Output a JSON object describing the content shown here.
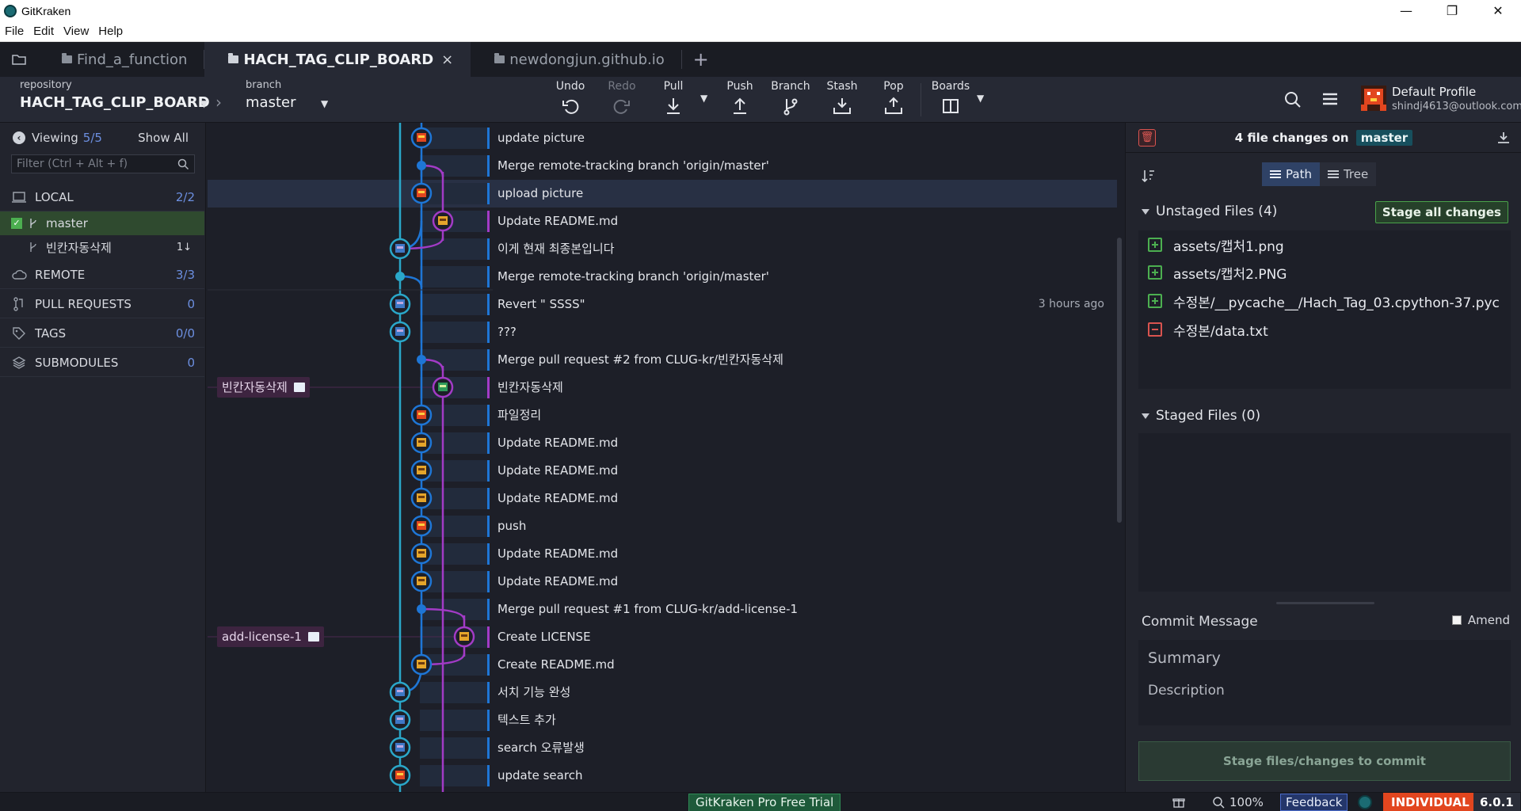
{
  "app": {
    "title": "GitKraken"
  },
  "menu": [
    "File",
    "Edit",
    "View",
    "Help"
  ],
  "tabs": [
    {
      "label": "Find_a_function",
      "active": false
    },
    {
      "label": "HACH_TAG_CLIP_BOARD",
      "active": true,
      "close": "×"
    },
    {
      "label": "newdongjun.github.io",
      "active": false
    }
  ],
  "toolbar": {
    "repo_caption": "repository",
    "repo_name": "HACH_TAG_CLIP_BOARD",
    "branch_caption": "branch",
    "branch_name": "master",
    "undo": "Undo",
    "redo": "Redo",
    "pull": "Pull",
    "push": "Push",
    "branch": "Branch",
    "stash": "Stash",
    "pop": "Pop",
    "boards": "Boards",
    "profile_name": "Default Profile",
    "profile_email": "shindj4613@outlook.com"
  },
  "sidebar": {
    "viewing_label": "Viewing",
    "viewing_count": "5/5",
    "show_all": "Show All",
    "filter_placeholder": "Filter (Ctrl + Alt + f)",
    "local": {
      "label": "LOCAL",
      "count": "2/2"
    },
    "local_branches": [
      {
        "name": "master",
        "checked": true,
        "badge": ""
      },
      {
        "name": "빈칸자동삭제",
        "checked": false,
        "badge": "1↓"
      }
    ],
    "remote": {
      "label": "REMOTE",
      "count": "3/3"
    },
    "pull_requests": {
      "label": "PULL REQUESTS",
      "count": "0"
    },
    "tags": {
      "label": "TAGS",
      "count": "0/0"
    },
    "submodules": {
      "label": "SUBMODULES",
      "count": "0"
    }
  },
  "graph": {
    "commits": [
      {
        "message": "update picture",
        "lane": 1,
        "avatar": "red",
        "bar": "blue"
      },
      {
        "message": "Merge remote-tracking branch 'origin/master'",
        "lane": 1,
        "avatar": "dot",
        "bar": "blue"
      },
      {
        "message": "upload picture",
        "lane": 1,
        "avatar": "red",
        "bar": "blue",
        "selected": true
      },
      {
        "message": "Update README.md",
        "lane": 2,
        "avatar": "yellow",
        "bar": "purple"
      },
      {
        "message": "이게 현재 최종본입니다",
        "lane": 0,
        "avatar": "blue",
        "bar": "blue"
      },
      {
        "message": "Merge remote-tracking branch 'origin/master'",
        "lane": 0,
        "avatar": "dot",
        "bar": "blue"
      },
      {
        "message": "Revert \" SSSS\"",
        "lane": 0,
        "avatar": "blue",
        "bar": "blue",
        "when": "3 hours ago"
      },
      {
        "message": "???",
        "lane": 0,
        "avatar": "blue",
        "bar": "blue"
      },
      {
        "message": "Merge pull request #2 from CLUG-kr/빈칸자동삭제",
        "lane": 1,
        "avatar": "dot",
        "bar": "blue"
      },
      {
        "message": "빈칸자동삭제",
        "lane": 2,
        "avatar": "green",
        "bar": "purple"
      },
      {
        "message": "파일정리",
        "lane": 1,
        "avatar": "red",
        "bar": "blue"
      },
      {
        "message": "Update README.md",
        "lane": 1,
        "avatar": "yellow",
        "bar": "blue"
      },
      {
        "message": "Update README.md",
        "lane": 1,
        "avatar": "yellow",
        "bar": "blue"
      },
      {
        "message": "Update README.md",
        "lane": 1,
        "avatar": "yellow",
        "bar": "blue"
      },
      {
        "message": "push",
        "lane": 1,
        "avatar": "red",
        "bar": "blue"
      },
      {
        "message": "Update README.md",
        "lane": 1,
        "avatar": "yellow",
        "bar": "blue"
      },
      {
        "message": "Update README.md",
        "lane": 1,
        "avatar": "yellow",
        "bar": "blue"
      },
      {
        "message": "Merge pull request #1 from CLUG-kr/add-license-1",
        "lane": 1,
        "avatar": "dot",
        "bar": "blue"
      },
      {
        "message": "Create LICENSE",
        "lane": 3,
        "avatar": "yellow",
        "bar": "purple"
      },
      {
        "message": "Create README.md",
        "lane": 1,
        "avatar": "yellow",
        "bar": "blue"
      },
      {
        "message": "서치 기능 완성",
        "lane": 0,
        "avatar": "blue",
        "bar": "blue"
      },
      {
        "message": "텍스트 추가",
        "lane": 0,
        "avatar": "blue",
        "bar": "blue"
      },
      {
        "message": "search 오류발생",
        "lane": 0,
        "avatar": "blue",
        "bar": "blue"
      },
      {
        "message": "update search",
        "lane": 0,
        "avatar": "red",
        "bar": "blue"
      }
    ],
    "branch_labels": [
      {
        "name": "빈칸자동삭제",
        "row": 9
      },
      {
        "name": "add-license-1",
        "row": 18
      }
    ]
  },
  "changes": {
    "title_prefix": "4 file changes on",
    "branch": "master",
    "path_label": "Path",
    "tree_label": "Tree",
    "unstaged_title": "Unstaged Files (4)",
    "stage_all": "Stage all changes",
    "unstaged": [
      {
        "path": "assets/캡처1.png",
        "type": "add"
      },
      {
        "path": "assets/캡처2.PNG",
        "type": "add"
      },
      {
        "path": "수정본/__pycache__/Hach_Tag_03.cpython-37.pyc",
        "type": "add"
      },
      {
        "path": "수정본/data.txt",
        "type": "remove"
      }
    ],
    "staged_title": "Staged Files (0)",
    "commit_message_title": "Commit Message",
    "amend": "Amend",
    "summary_placeholder": "Summary",
    "description_placeholder": "Description",
    "stage_commit_button": "Stage files/changes to commit"
  },
  "statusbar": {
    "pro_trial": "GitKraken Pro Free Trial",
    "zoom": "100%",
    "feedback": "Feedback",
    "license": "INDIVIDUAL",
    "version": "6.0.1"
  }
}
